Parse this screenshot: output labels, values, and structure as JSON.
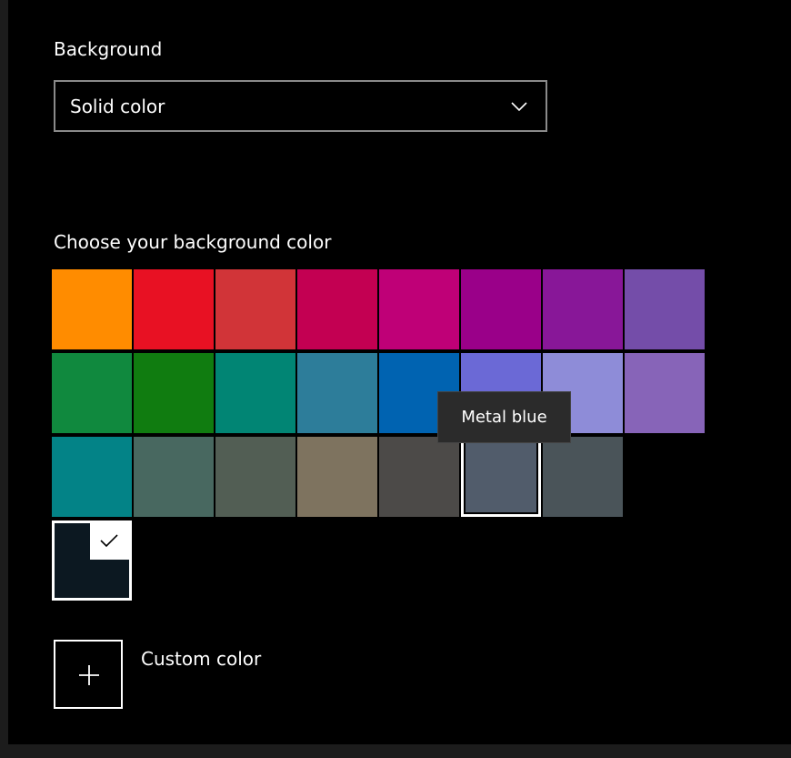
{
  "background": {
    "label": "Background",
    "dropdown_value": "Solid color"
  },
  "color_picker": {
    "label": "Choose your background color",
    "swatches": [
      "#ff8c00",
      "#e81123",
      "#d13438",
      "#c30052",
      "#bf0077",
      "#9a0089",
      "#881798",
      "#744da9",
      "#10893e",
      "#107c10",
      "#018574",
      "#2d7d9a",
      "#0063b1",
      "#6b69d6",
      "#8e8cd8",
      "#8764b8",
      "#038387",
      "#486860",
      "#525e54",
      "#7e735f",
      "#4c4a48",
      "#515c6b",
      "#4a5459"
    ],
    "hovered_index": 21,
    "tooltip": "Metal blue",
    "selected_color": "#0c1821"
  },
  "custom": {
    "label": "Custom color"
  },
  "icons": {
    "dropdown": "chevron-down-icon",
    "selected": "checkmark-icon",
    "custom": "plus-icon"
  }
}
